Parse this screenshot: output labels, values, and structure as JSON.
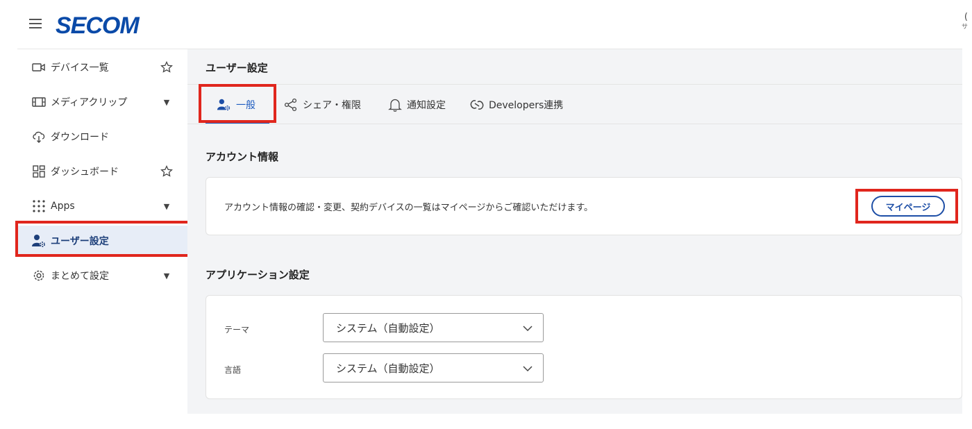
{
  "header": {
    "logo_text": "SECOM",
    "right_top": "(",
    "right_sub": "サ"
  },
  "sidebar": {
    "items": [
      {
        "label": "デバイス一覧",
        "icon": "camera-icon",
        "trail": "star"
      },
      {
        "label": "メディアクリップ",
        "icon": "film-icon",
        "trail": "caret"
      },
      {
        "label": "ダウンロード",
        "icon": "cloud-download-icon",
        "trail": ""
      },
      {
        "label": "ダッシュボード",
        "icon": "dashboard-icon",
        "trail": "star"
      },
      {
        "label": "Apps",
        "icon": "apps-grid-icon",
        "trail": "caret"
      },
      {
        "label": "ユーザー設定",
        "icon": "user-gear-icon",
        "trail": "",
        "active": true
      },
      {
        "label": "まとめて設定",
        "icon": "gear-icon",
        "trail": "caret"
      }
    ]
  },
  "main": {
    "page_title": "ユーザー設定",
    "tabs": [
      {
        "label": "一般",
        "icon": "user-gear-icon",
        "active": true
      },
      {
        "label": "シェア・権限",
        "icon": "share-icon"
      },
      {
        "label": "通知設定",
        "icon": "bell-icon"
      },
      {
        "label": "Developers連携",
        "icon": "link-icon"
      }
    ],
    "account": {
      "title": "アカウント情報",
      "description": "アカウント情報の確認・変更、契約デバイスの一覧はマイページからご確認いただけます。",
      "mypage_button": "マイページ"
    },
    "app_settings": {
      "title": "アプリケーション設定",
      "theme_label": "テーマ",
      "theme_value": "システム（自動設定）",
      "language_label": "言語",
      "language_value": "システム（自動設定）"
    }
  },
  "colors": {
    "brand": "#0a4aa8",
    "accent": "#1d5bbf",
    "highlight": "#e0261d",
    "active_bg": "#e7edf7"
  }
}
